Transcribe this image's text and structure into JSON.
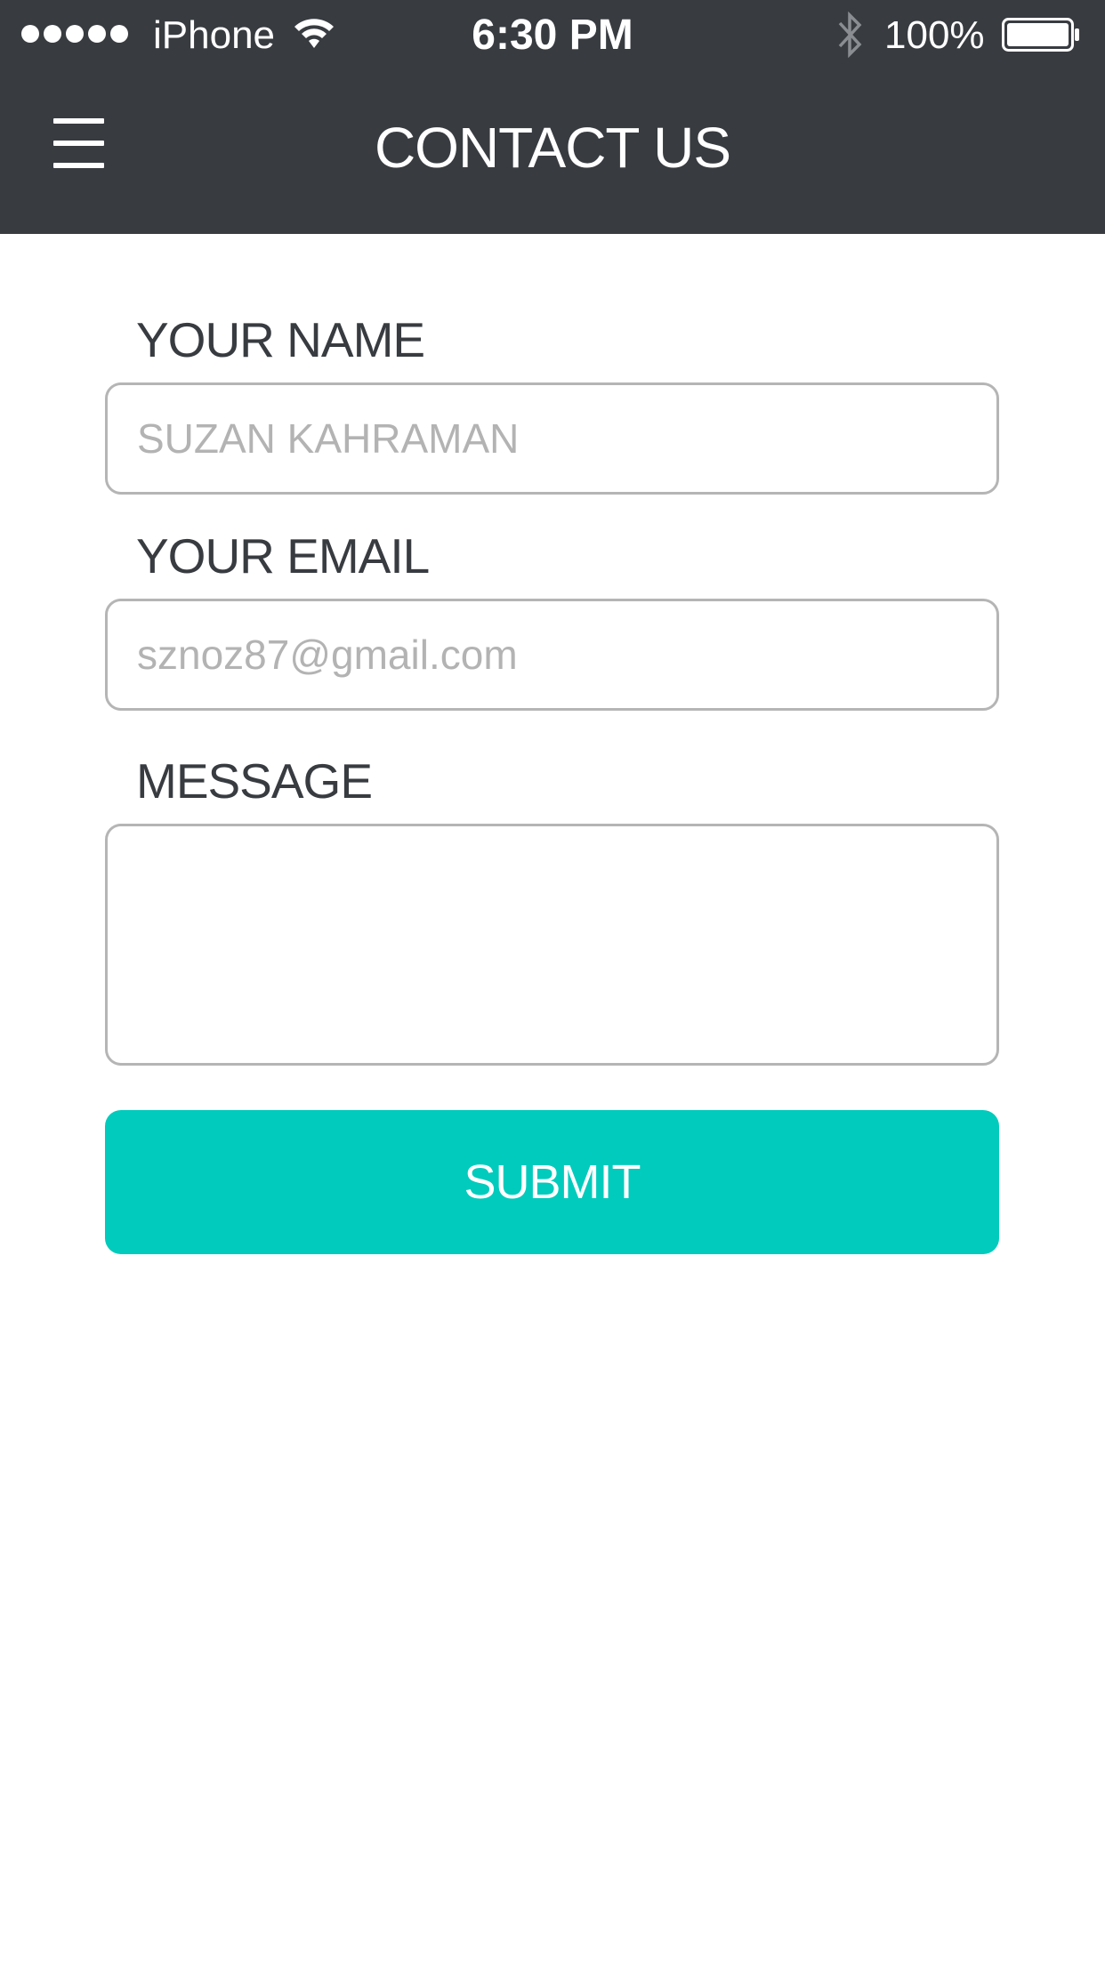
{
  "status_bar": {
    "carrier": "iPhone",
    "time": "6:30 PM",
    "battery_percent": "100%",
    "signal_bars": 5,
    "battery_level": 1.0
  },
  "nav": {
    "title": "CONTACT US",
    "menu_icon": "hamburger-menu-icon"
  },
  "form": {
    "name_label": "YOUR NAME",
    "name_placeholder": "SUZAN KAHRAMAN",
    "email_label": "YOUR EMAIL",
    "email_placeholder": "sznoz87@gmail.com",
    "message_label": "MESSAGE",
    "message_value": "",
    "submit_label": "SUBMIT"
  },
  "colors": {
    "header_bg": "#383c41",
    "accent": "#00cbbc",
    "field_border": "#b5b5b5",
    "placeholder": "#b3b3b3",
    "label_text": "#383c41"
  }
}
